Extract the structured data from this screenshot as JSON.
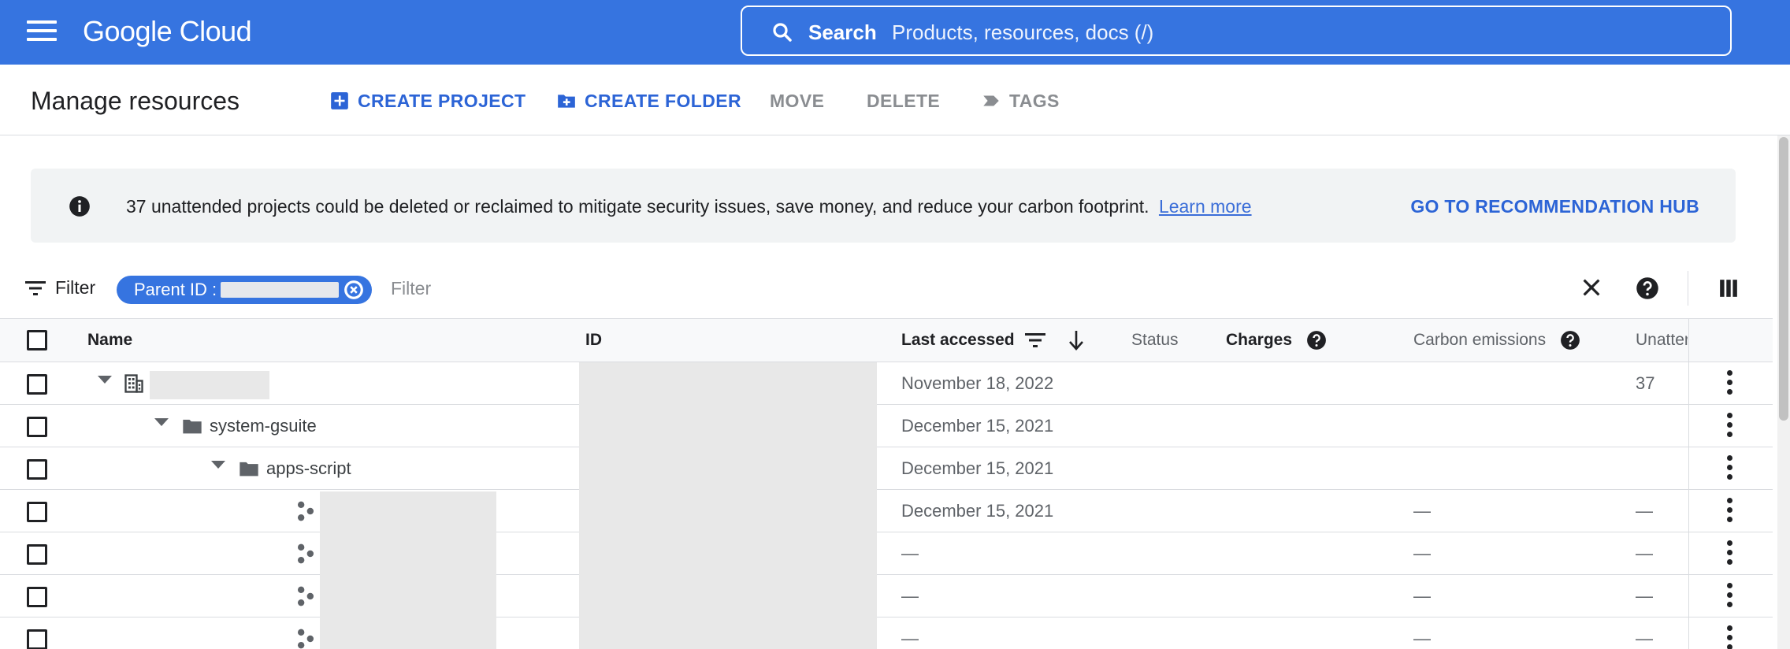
{
  "topbar": {
    "logo": "Google Cloud",
    "search_label": "Search",
    "search_placeholder": "Products, resources, docs (/)"
  },
  "toolbar": {
    "title": "Manage resources",
    "create_project": "CREATE PROJECT",
    "create_folder": "CREATE FOLDER",
    "move": "MOVE",
    "delete": "DELETE",
    "tags": "TAGS"
  },
  "banner": {
    "message": "37 unattended projects could be deleted or reclaimed to mitigate security issues, save money, and reduce your carbon footprint.",
    "link": "Learn more",
    "action": "GO TO RECOMMENDATION HUB"
  },
  "filter": {
    "label": "Filter",
    "chip_label": "Parent ID :",
    "placeholder": "Filter"
  },
  "table": {
    "columns": {
      "name": "Name",
      "id": "ID",
      "last_accessed": "Last accessed",
      "status": "Status",
      "charges": "Charges",
      "carbon": "Carbon emissions",
      "unattended": "Unatter"
    },
    "rows": [
      {
        "name": "",
        "type": "organization",
        "last_accessed": "November 18, 2022",
        "carbon": "",
        "unattended": "37"
      },
      {
        "name": "system-gsuite",
        "type": "folder",
        "last_accessed": "December 15, 2021",
        "carbon": "",
        "unattended": ""
      },
      {
        "name": "apps-script",
        "type": "folder",
        "last_accessed": "December 15, 2021",
        "carbon": "",
        "unattended": ""
      },
      {
        "name": "",
        "type": "project",
        "last_accessed": "December 15, 2021",
        "carbon": "—",
        "unattended": "—"
      },
      {
        "name": "",
        "type": "project",
        "last_accessed": "—",
        "carbon": "—",
        "unattended": "—"
      },
      {
        "name": "",
        "type": "project",
        "last_accessed": "—",
        "carbon": "—",
        "unattended": "—"
      },
      {
        "name": "",
        "type": "project",
        "last_accessed": "—",
        "carbon": "—",
        "unattended": "—"
      }
    ]
  },
  "colors": {
    "brand_blue": "#3674e0",
    "action_blue": "#2c64d6",
    "disabled_grey": "#8a8d91",
    "banner_bg": "#f1f3f4"
  }
}
